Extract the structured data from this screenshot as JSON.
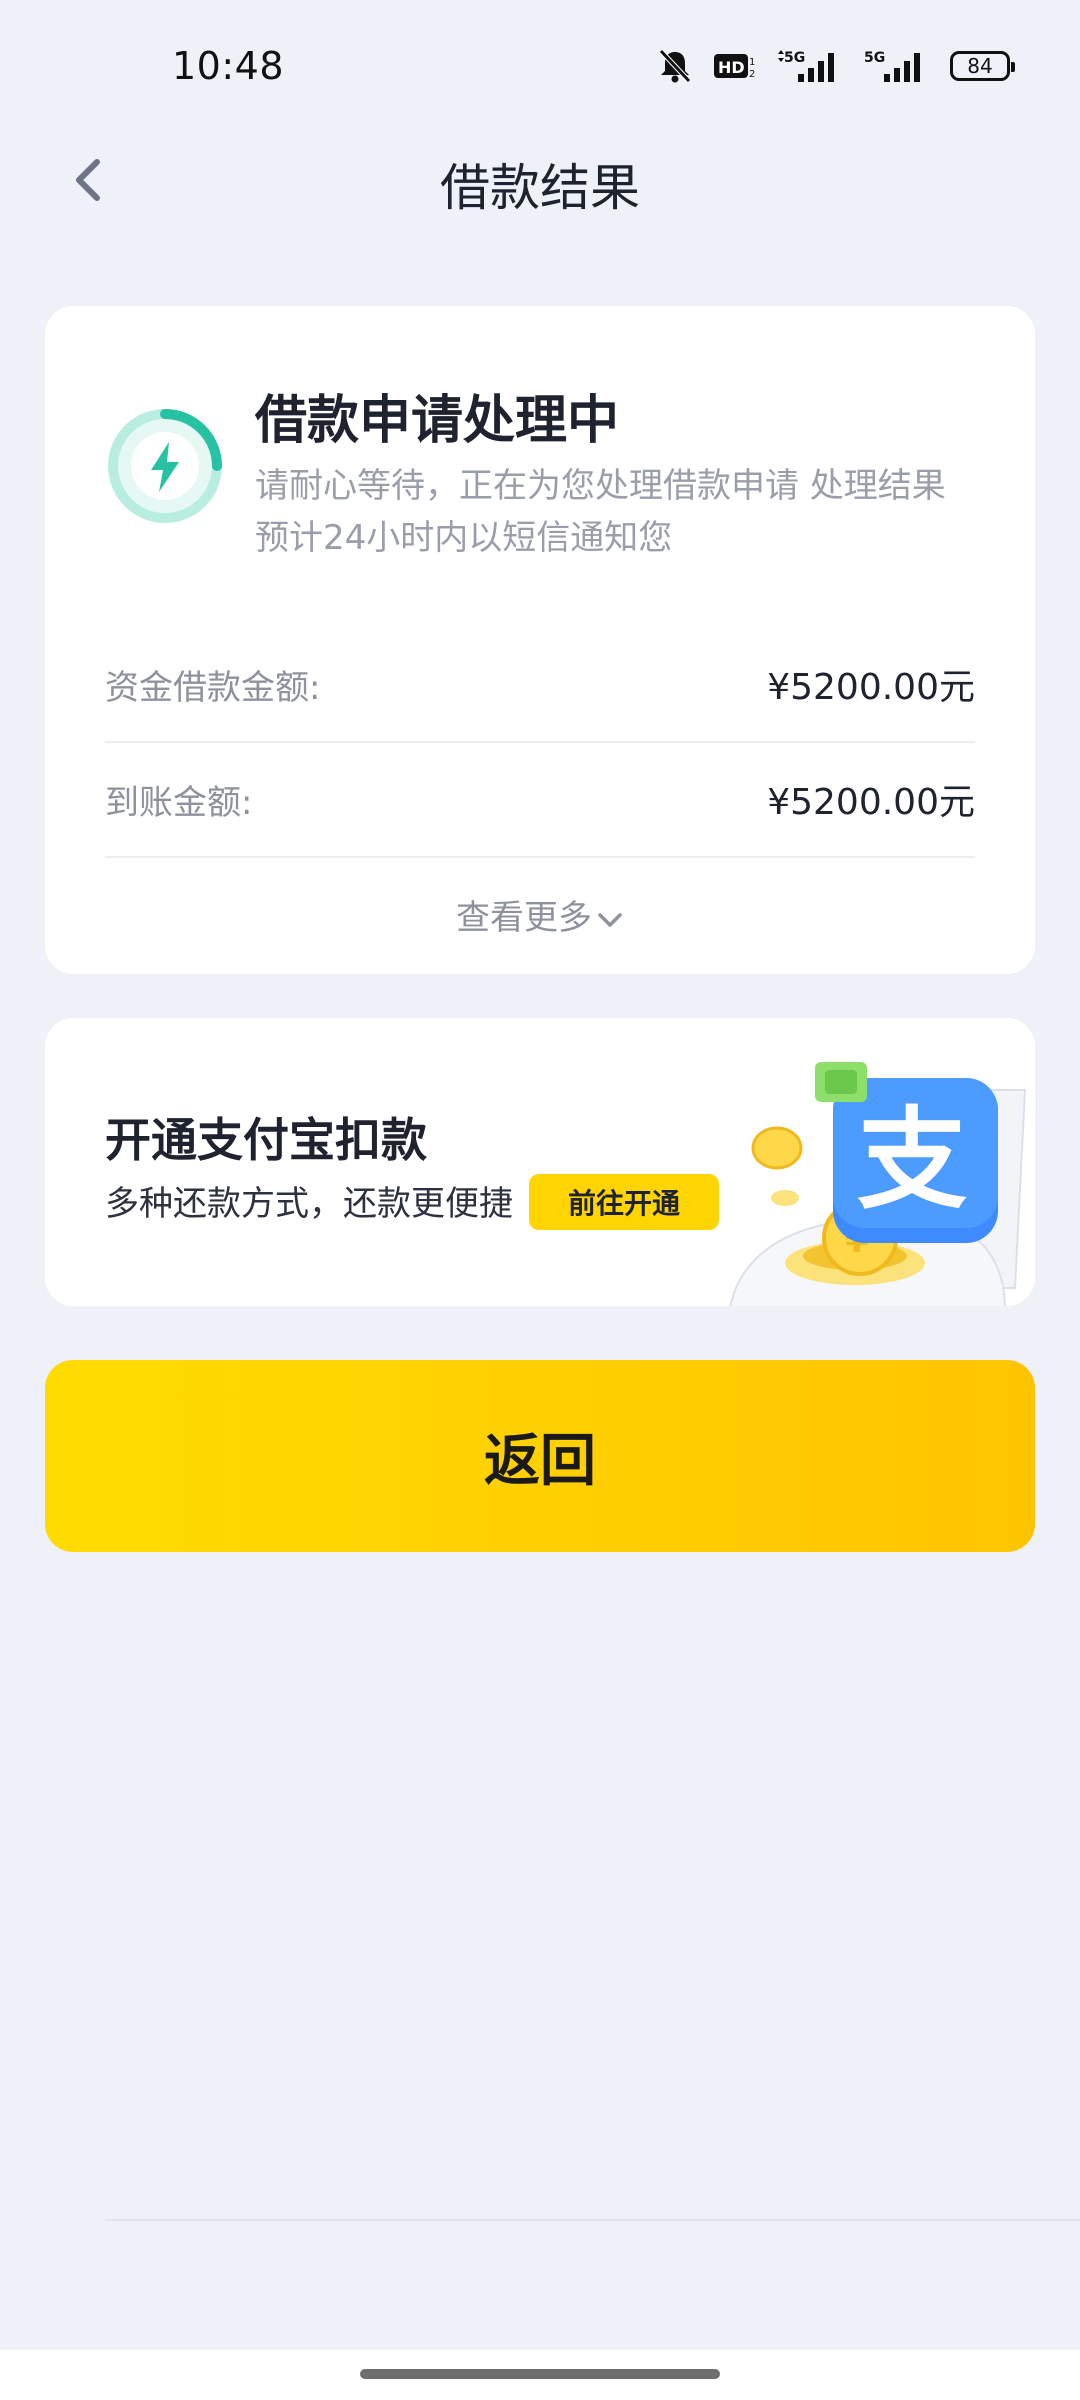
{
  "status_bar": {
    "time": "10:48",
    "battery": "84",
    "icons": [
      "bell-off-icon",
      "hd-icon",
      "signal-5g-icon",
      "signal-5g-icon",
      "battery-icon"
    ]
  },
  "header": {
    "title": "借款结果",
    "back_icon": "chevron-left-icon"
  },
  "status_card": {
    "title": "借款申请处理中",
    "description": "请耐心等待，正在为您处理借款申请 处理结果预计24小时内以短信通知您",
    "icon": "lightning-icon",
    "accent_color": "#27C2A4",
    "rows": [
      {
        "label": "资金借款金额:",
        "value": "¥5200.00元"
      },
      {
        "label": "到账金额:",
        "value": "¥5200.00元"
      }
    ],
    "more_label": "查看更多"
  },
  "alipay_card": {
    "title": "开通支付宝扣款",
    "description": "多种还款方式，还款更便捷",
    "button_label": "前往开通",
    "illustration_char": "支"
  },
  "return_button": {
    "label": "返回",
    "color_start": "#FFDC00",
    "color_end": "#FFC400"
  }
}
